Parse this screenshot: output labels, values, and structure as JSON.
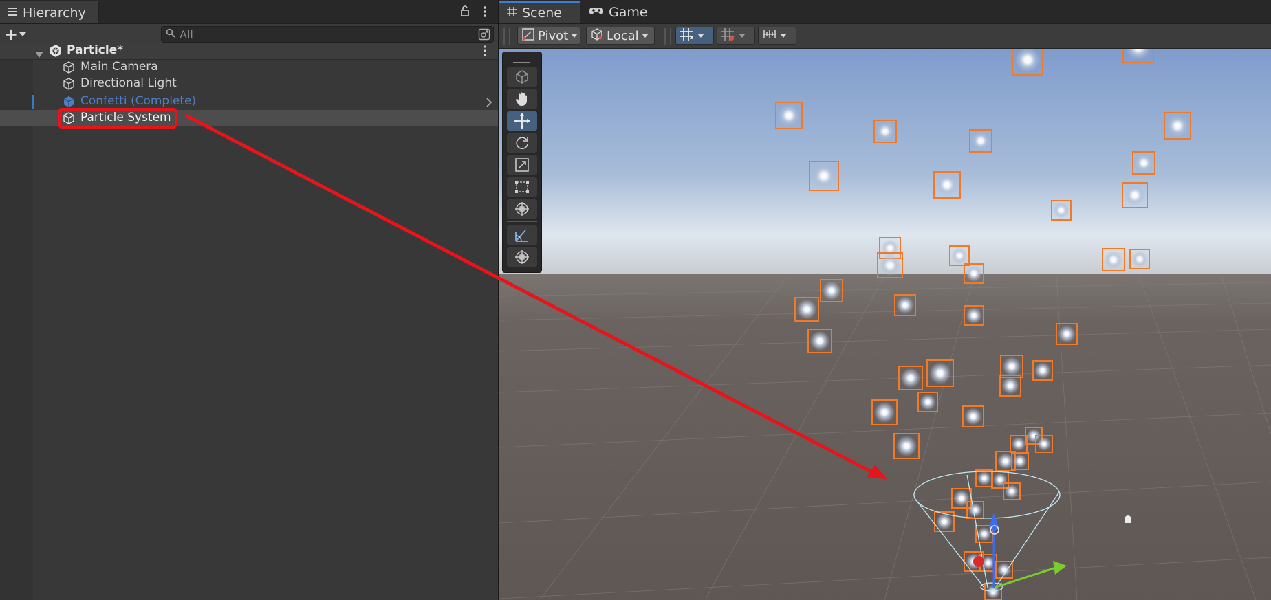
{
  "hierarchy": {
    "tab_label": "Hierarchy",
    "add_label": "+",
    "search": {
      "placeholder": "All",
      "value": ""
    },
    "scene": {
      "label": "Particle*"
    },
    "items": [
      {
        "label": "Main Camera",
        "type": "gameobject"
      },
      {
        "label": "Directional Light",
        "type": "gameobject"
      },
      {
        "label": "Confetti (Complete)",
        "type": "prefab-missing"
      },
      {
        "label": "Particle System",
        "type": "gameobject",
        "selected": true
      }
    ]
  },
  "scene_view": {
    "tabs": [
      {
        "label": "Scene",
        "icon": "grid-icon",
        "active": true
      },
      {
        "label": "Game",
        "icon": "gamepad-icon",
        "active": false
      }
    ],
    "toolbar": {
      "pivot_label": "Pivot",
      "space_label": "Local"
    },
    "tools": [
      "view-tool",
      "hand-tool",
      "move-tool",
      "rotate-tool",
      "scale-tool",
      "rect-tool",
      "transform-tool",
      "custom-tool",
      "custom-tool-2"
    ],
    "active_tool": "move-tool"
  },
  "colors": {
    "selection_outline": "#f07a2a",
    "annotation": "#e8141b",
    "prefab_missing_text": "#4e7fc4",
    "sky_top": "#7f9fcb",
    "ground": "#625b56"
  }
}
